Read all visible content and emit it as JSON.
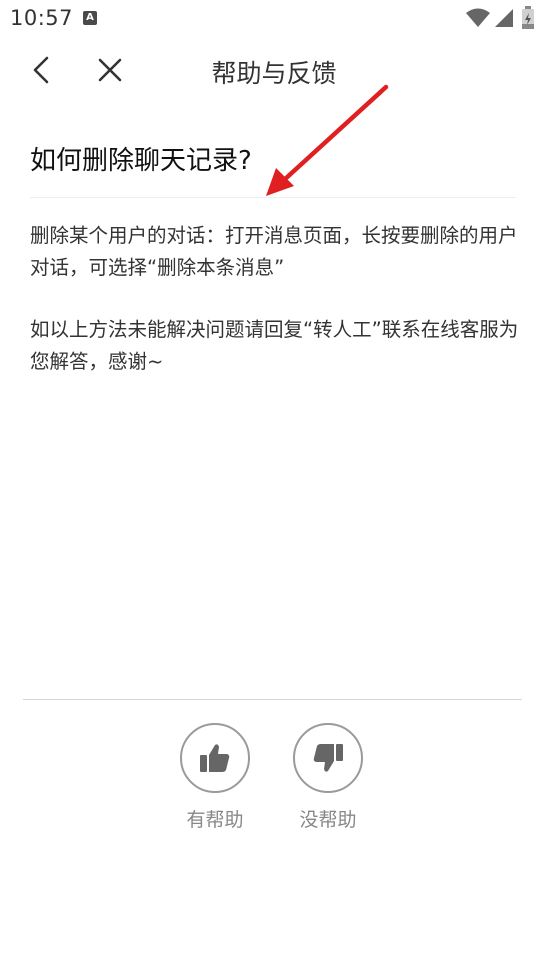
{
  "status_bar": {
    "time": "10:57",
    "app_badge": "A",
    "icons": [
      "wifi-icon",
      "signal-icon",
      "battery-icon"
    ]
  },
  "nav": {
    "title": "帮助与反馈",
    "icons": [
      "back-icon",
      "close-icon"
    ]
  },
  "question": {
    "title": "如何删除聊天记录?"
  },
  "answer": {
    "paragraphs": [
      "删除某个用户的对话：打开消息页面，长按要删除的用户对话，可选择“删除本条消息”",
      "如以上方法未能解决问题请回复“转人工”联系在线客服为您解答，感谢~"
    ]
  },
  "feedback": {
    "helpful_label": "有帮助",
    "unhelpful_label": "没帮助",
    "icons": [
      "thumbs-up-icon",
      "thumbs-down-icon"
    ]
  },
  "colors": {
    "annotation_arrow": "#e02020",
    "circle_border": "#9a9a9a",
    "icon_fill": "#666666",
    "label_gray": "#888888"
  }
}
